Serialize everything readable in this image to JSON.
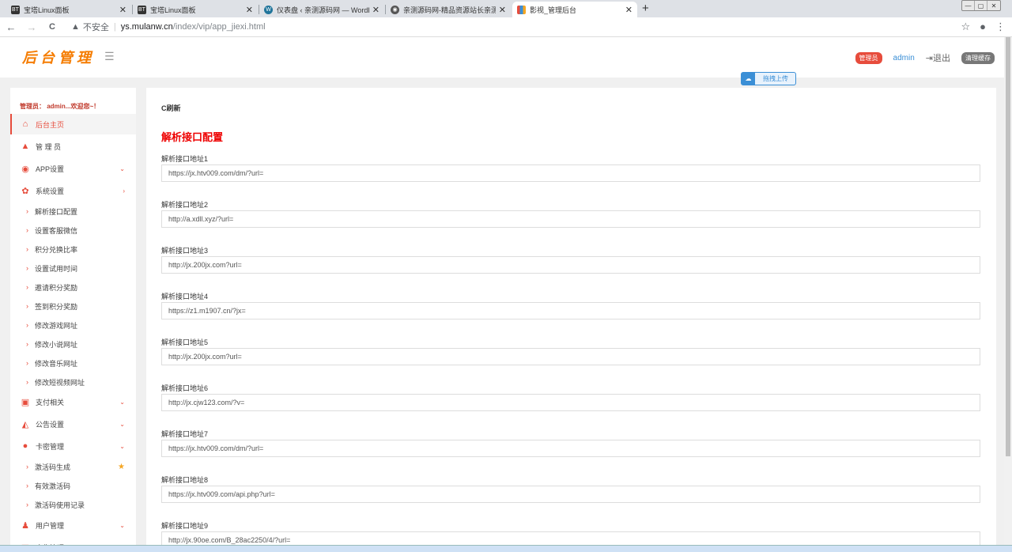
{
  "browser": {
    "tabs": [
      {
        "label": "宝塔Linux面板",
        "icon": "BT",
        "icon_color": "#20a53a"
      },
      {
        "label": "宝塔Linux面板",
        "icon": "BT",
        "icon_color": "#20a53a"
      },
      {
        "label": "仪表盘 ‹ 亲测源码网 — WordPr…",
        "icon": "W",
        "icon_color": "#21759b"
      },
      {
        "label": "亲测源码网-精品资源站长亲测",
        "icon": "◉",
        "icon_color": "#555555"
      },
      {
        "label": "影视_管理后台",
        "icon": "▌",
        "icon_color": "#e74c3c"
      }
    ],
    "new_tab": "+",
    "window_controls": [
      "—",
      "▢",
      "✕"
    ],
    "back": "←",
    "forward": "→",
    "reload": "C",
    "security_icon": "▲",
    "insecure_label": "不安全",
    "url_domain": "ys.mulanw.cn",
    "url_path": "/index/vip/app_jiexi.html",
    "star_icon": "☆",
    "profile_icon": "●",
    "menu_icon": "⋮"
  },
  "header": {
    "logo": "后台管理",
    "menu_toggle": "☰",
    "role_badge": "管理员",
    "username": "admin",
    "logout": "⇥退出",
    "clear_cache": "清理缓存"
  },
  "upload": {
    "icon": "☁",
    "label": "拖拽上传"
  },
  "sidebar": {
    "greeting": "管理员：  admin...欢迎您~！",
    "nav": [
      {
        "label": "后台主页",
        "icon": "⌂",
        "icon_color": "#e74c3c",
        "arrow": ""
      },
      {
        "label": "管 理 员",
        "icon": "▲",
        "icon_color": "#e74c3c",
        "arrow": ""
      },
      {
        "label": "APP设置",
        "icon": "◉",
        "icon_color": "#e74c3c",
        "arrow": "⌄"
      },
      {
        "label": "系统设置",
        "icon": "✿",
        "icon_color": "#e74c3c",
        "arrow": "›"
      }
    ],
    "system_sub": [
      "解析接口配置",
      "设置客服微信",
      "积分兑换比率",
      "设置试用时间",
      "邀请积分奖励",
      "签到积分奖励",
      "修改游戏网址",
      "修改小说网址",
      "修改音乐网址",
      "修改短视频网址"
    ],
    "nav2": [
      {
        "label": "支付相关",
        "icon": "▣",
        "icon_color": "#e74c3c",
        "arrow": "⌄"
      },
      {
        "label": "公告设置",
        "icon": "◭",
        "icon_color": "#e74c3c",
        "arrow": "⌄"
      },
      {
        "label": "卡密管理",
        "icon": "●",
        "icon_color": "#e74c3c",
        "arrow": "⌄"
      }
    ],
    "card_sub": [
      "激活码生成",
      "有效激活码",
      "激活码使用记录"
    ],
    "card_star": "★",
    "nav3": [
      {
        "label": "用户管理",
        "icon": "♟",
        "icon_color": "#e74c3c",
        "arrow": "⌄"
      },
      {
        "label": "广告管理",
        "icon": "▤",
        "icon_color": "#e74c3c",
        "arrow": "›"
      }
    ]
  },
  "main": {
    "refresh": "C刷新",
    "title": "解析接口配置",
    "fields": [
      {
        "label": "解析接口地址1",
        "value": "https://jx.htv009.com/dm/?url="
      },
      {
        "label": "解析接口地址2",
        "value": "http://a.xdll.xyz/?url="
      },
      {
        "label": "解析接口地址3",
        "value": "http://jx.200jx.com?url="
      },
      {
        "label": "解析接口地址4",
        "value": "https://z1.m1907.cn/?jx="
      },
      {
        "label": "解析接口地址5",
        "value": "http://jx.200jx.com?url="
      },
      {
        "label": "解析接口地址6",
        "value": "http://jx.cjw123.com/?v="
      },
      {
        "label": "解析接口地址7",
        "value": "https://jx.htv009.com/dm/?url="
      },
      {
        "label": "解析接口地址8",
        "value": "https://jx.htv009.com/api.php?url="
      },
      {
        "label": "解析接口地址9",
        "value": "http://jx.90oe.com/B_28ac2250/4/?url="
      }
    ]
  }
}
